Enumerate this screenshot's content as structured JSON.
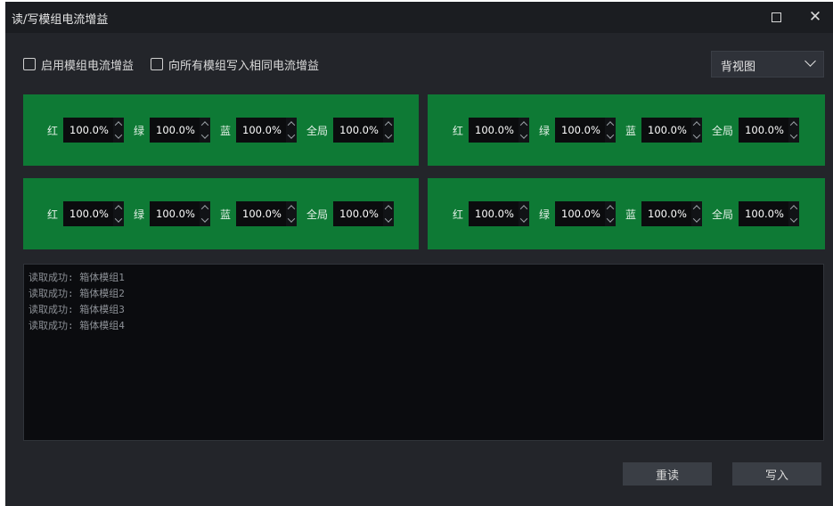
{
  "window": {
    "title": "读/写模组电流增益"
  },
  "options": {
    "enable_label": "启用模组电流增益",
    "write_same_label": "向所有模组写入相同电流增益",
    "view_select": "背视图"
  },
  "panels": [
    {
      "fields": [
        {
          "label": "红",
          "value": "100.0%"
        },
        {
          "label": "绿",
          "value": "100.0%"
        },
        {
          "label": "蓝",
          "value": "100.0%"
        },
        {
          "label": "全局",
          "value": "100.0%"
        }
      ]
    },
    {
      "fields": [
        {
          "label": "红",
          "value": "100.0%"
        },
        {
          "label": "绿",
          "value": "100.0%"
        },
        {
          "label": "蓝",
          "value": "100.0%"
        },
        {
          "label": "全局",
          "value": "100.0%"
        }
      ]
    },
    {
      "fields": [
        {
          "label": "红",
          "value": "100.0%"
        },
        {
          "label": "绿",
          "value": "100.0%"
        },
        {
          "label": "蓝",
          "value": "100.0%"
        },
        {
          "label": "全局",
          "value": "100.0%"
        }
      ]
    },
    {
      "fields": [
        {
          "label": "红",
          "value": "100.0%"
        },
        {
          "label": "绿",
          "value": "100.0%"
        },
        {
          "label": "蓝",
          "value": "100.0%"
        },
        {
          "label": "全局",
          "value": "100.0%"
        }
      ]
    }
  ],
  "log": [
    "读取成功: 箱体模组1",
    "读取成功: 箱体模组2",
    "读取成功: 箱体模组3",
    "读取成功: 箱体模组4"
  ],
  "buttons": {
    "reread": "重读",
    "write": "写入"
  },
  "colors": {
    "panel_green": "#0e7a35",
    "window_bg": "#23252a",
    "titlebar_bg": "#1b1d21"
  }
}
